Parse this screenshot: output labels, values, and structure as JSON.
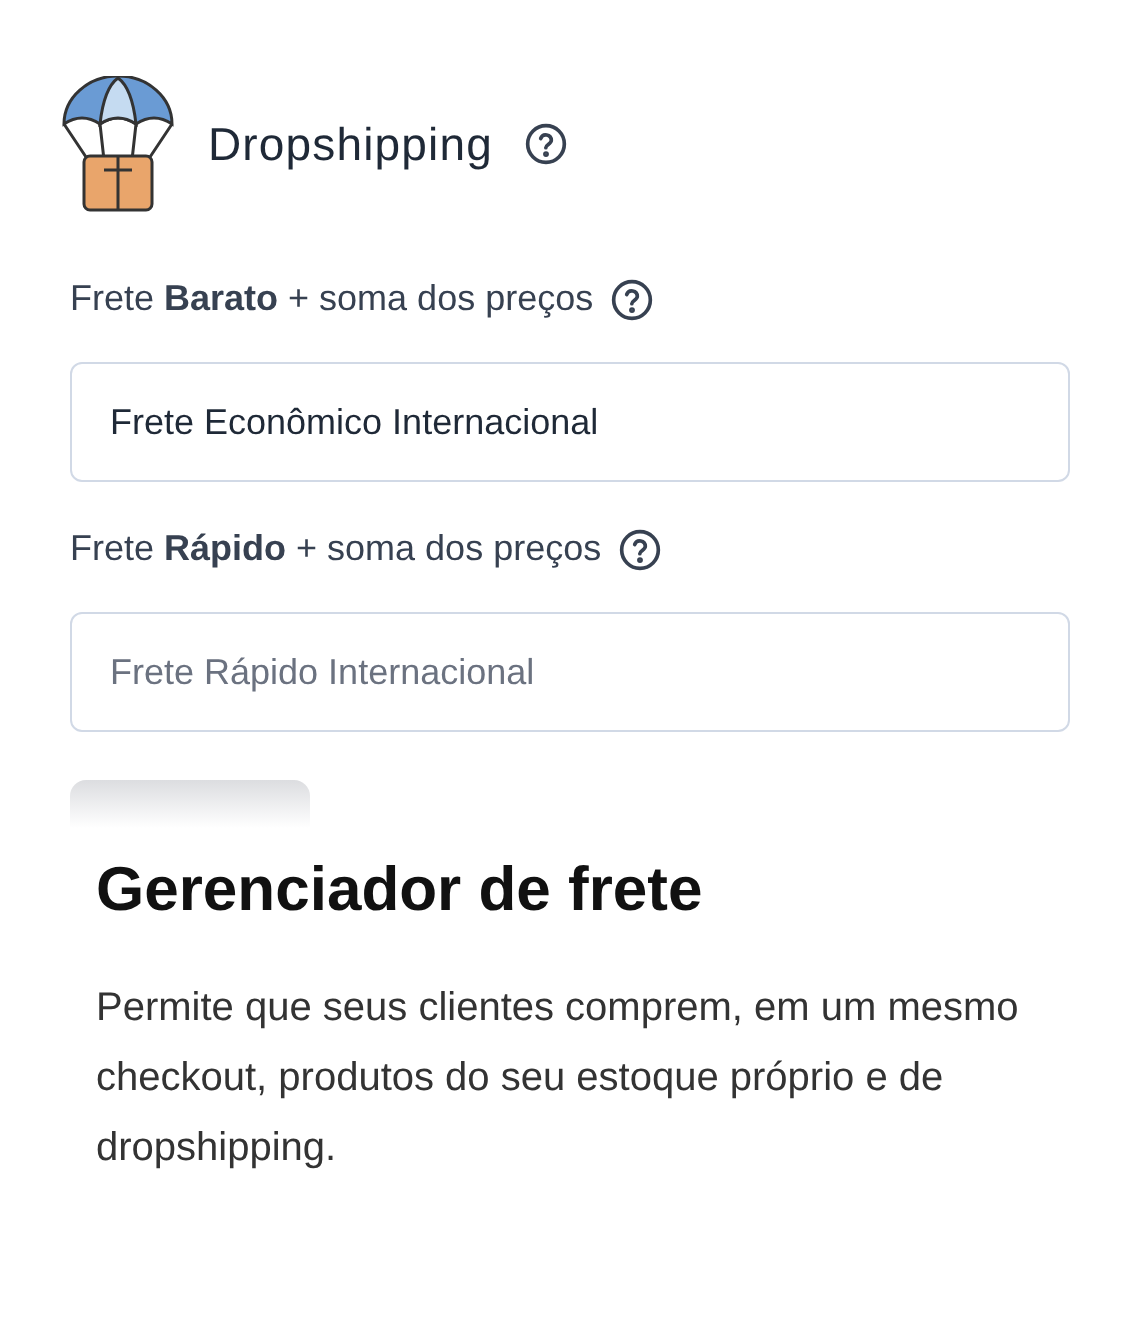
{
  "header": {
    "title": "Dropshipping"
  },
  "fields": [
    {
      "label": "Frete **Barato** + soma dos preços",
      "value": "Frete Econômico Internacional"
    },
    {
      "label": "Frete **Rápido** + soma dos preços",
      "placeholder": "Frete Rápido Internacional"
    }
  ],
  "feature": {
    "title": "Gerenciador de frete",
    "description": "Permite que seus clientes comprem, em um mesmo checkout, produtos do seu estoque próprio e de dropshipping."
  }
}
